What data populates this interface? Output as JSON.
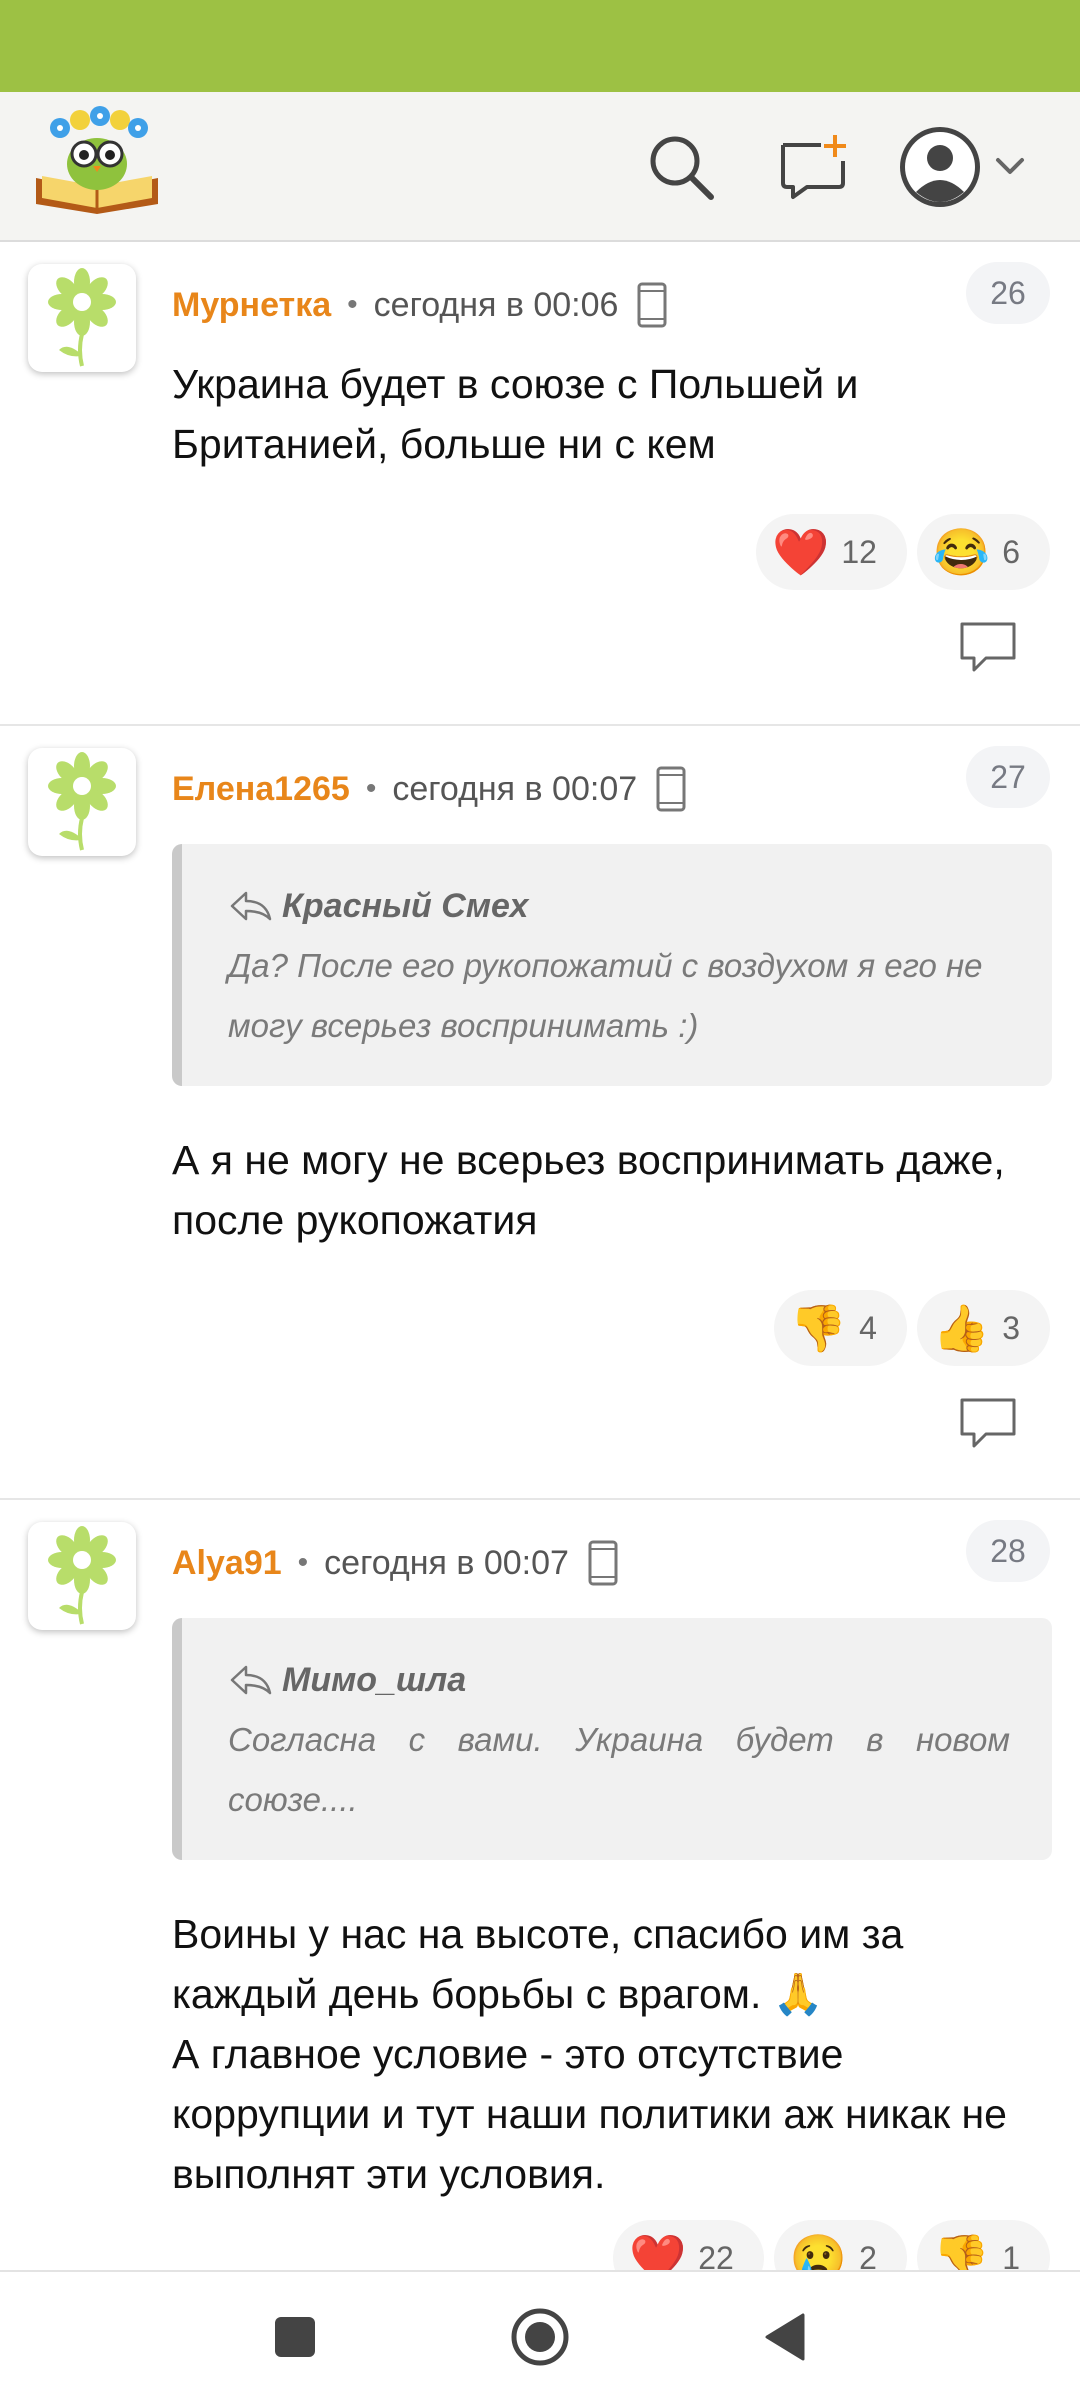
{
  "header": {
    "logo": "site-logo-owl-book",
    "icons": [
      "search-icon",
      "new-post-icon",
      "profile-icon",
      "chevron-down-icon"
    ]
  },
  "comments": [
    {
      "author": "Мурнетка",
      "time": "сегодня в 00:06",
      "number": "26",
      "text": "Украина будет в союзе с Польшей и Британией, больше ни с кем",
      "reactions": [
        {
          "emoji": "❤️",
          "count": "12"
        },
        {
          "emoji": "😂",
          "count": "6"
        }
      ]
    },
    {
      "author": "Елена1265",
      "time": "сегодня в 00:07",
      "number": "27",
      "quote": {
        "author": "Красный Смех",
        "text": "Да? После его рукопожатий с воздухом я его не могу всерьез воспринимать :)"
      },
      "text": "А я не могу не всерьез воспринимать даже, после рукопожатия",
      "reactions": [
        {
          "emoji": "👎",
          "count": "4"
        },
        {
          "emoji": "👍",
          "count": "3"
        }
      ]
    },
    {
      "author": "Alya91",
      "time": "сегодня в 00:07",
      "number": "28",
      "quote": {
        "author": "Мимо_шла",
        "text": "Согласна с вами. Украина будет в новом союзе...."
      },
      "text": "Воины у нас на высоте, спасибо им за каждый день борьбы с врагом. 🙏\nА главное условие - это отсутствие коррупции и тут наши политики аж никак не выполнят эти условия.",
      "reactions": [
        {
          "emoji": "❤️",
          "count": "22"
        },
        {
          "emoji": "😢",
          "count": "2"
        },
        {
          "emoji": "👎",
          "count": "1"
        }
      ]
    }
  ],
  "nav": {
    "icons": [
      "recent-apps-icon",
      "home-icon",
      "back-icon"
    ]
  },
  "colors": {
    "status_bar": "#9dc144",
    "author": "#e8861a",
    "header_bg": "#f4f4f2"
  }
}
